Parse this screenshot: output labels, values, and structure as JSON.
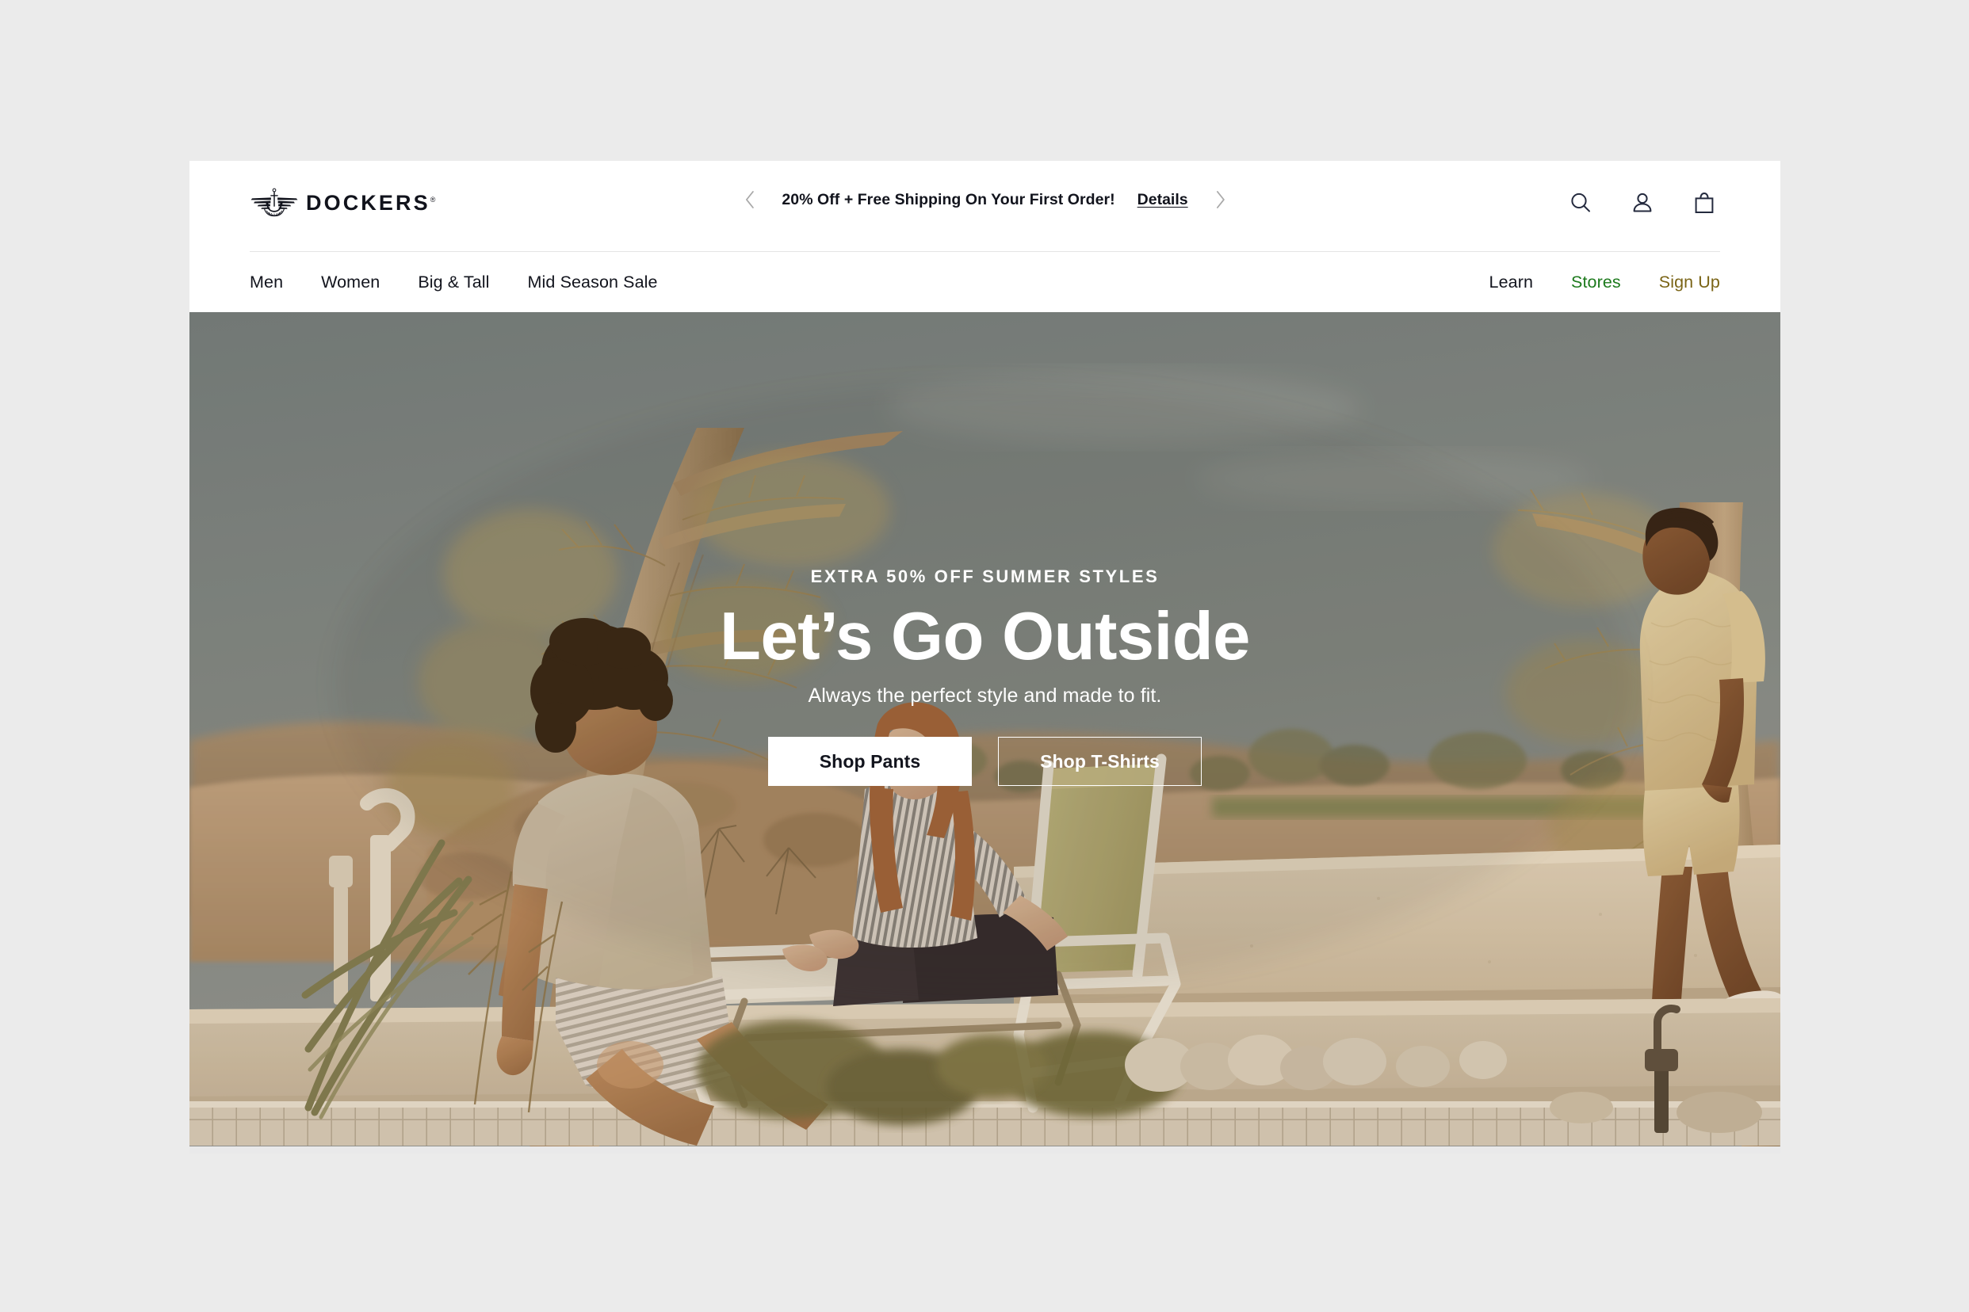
{
  "site": {
    "background_color": "#ebebeb",
    "page_background": "#ffffff"
  },
  "header": {
    "logo": {
      "wordmark": "DOCKERS",
      "trademark": "®",
      "icon": "dockers-wings-anchor-logo"
    },
    "promo": {
      "prev_icon": "chevron-left-icon",
      "next_icon": "chevron-right-icon",
      "text": "20% Off + Free Shipping On Your First Order!",
      "details_label": "Details"
    },
    "utilities": [
      {
        "name": "search-icon",
        "label": "Search"
      },
      {
        "name": "account-icon",
        "label": "Account"
      },
      {
        "name": "shopping-bag-icon",
        "label": "Bag"
      }
    ]
  },
  "nav": {
    "primary": [
      {
        "label": "Men",
        "accent": "default"
      },
      {
        "label": "Women",
        "accent": "default"
      },
      {
        "label": "Big & Tall",
        "accent": "default"
      },
      {
        "label": "Mid Season Sale",
        "accent": "default"
      }
    ],
    "secondary": [
      {
        "label": "Learn",
        "accent": "default",
        "color": "#12141d"
      },
      {
        "label": "Stores",
        "accent": "green",
        "color": "#1d7a1d"
      },
      {
        "label": "Sign Up",
        "accent": "gold",
        "color": "#7a6416"
      }
    ]
  },
  "hero": {
    "eyebrow": "EXTRA 50% OFF SUMMER STYLES",
    "headline": "Let’s Go Outside",
    "subtitle": "Always the perfect style and made to fit.",
    "cta_primary": "Shop Pants",
    "cta_secondary": "Shop T-Shirts",
    "image_description": "Two men and a woman relaxing poolside in a desert landscape with a lounge chair, bare trees and a stucco wall",
    "palette": {
      "sky": "#7b8688",
      "sand": "#b79a78",
      "stucco": "#d8cbb4",
      "chair_sling": "#b5b07a",
      "text": "#ffffff"
    }
  }
}
